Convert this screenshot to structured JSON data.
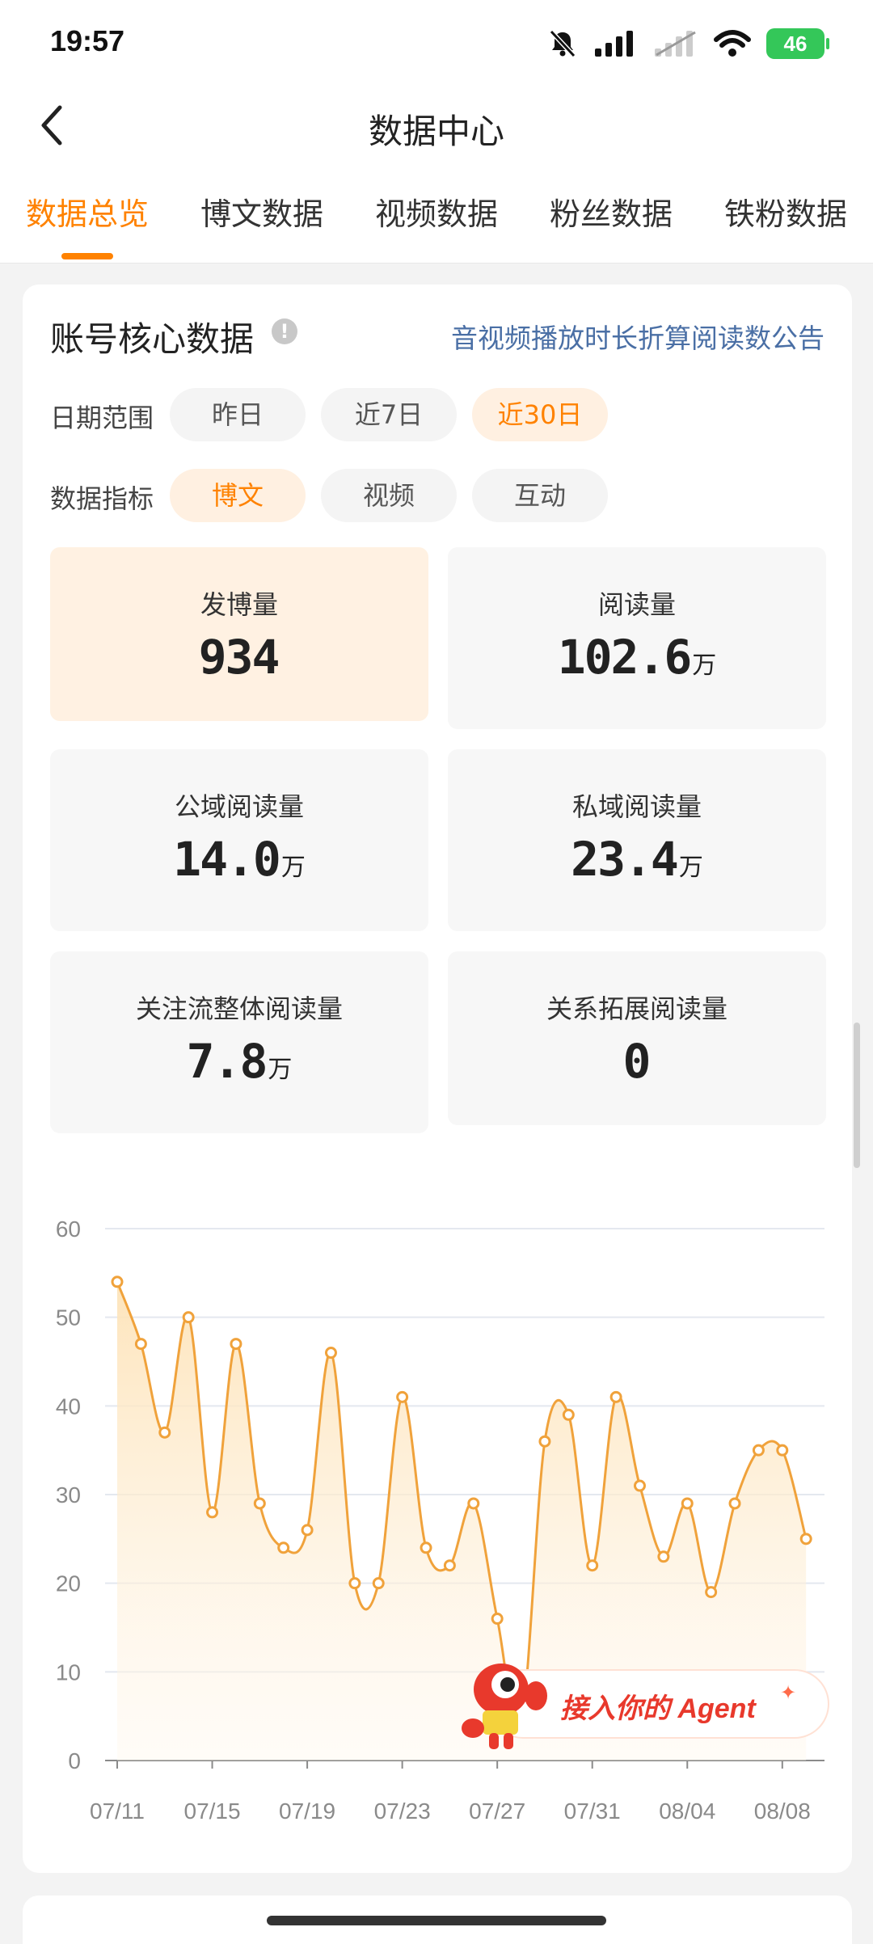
{
  "status_bar": {
    "time": "19:57",
    "battery": "46"
  },
  "header": {
    "title": "数据中心"
  },
  "tabs": [
    {
      "label": "数据总览"
    },
    {
      "label": "博文数据"
    },
    {
      "label": "视频数据"
    },
    {
      "label": "粉丝数据"
    },
    {
      "label": "铁粉数据"
    }
  ],
  "card": {
    "title": "账号核心数据",
    "info_icon": "!",
    "announcement": "音视频播放时长折算阅读数公告",
    "date_range": {
      "label": "日期范围",
      "options": [
        "昨日",
        "近7日",
        "近30日"
      ],
      "selected": "近30日"
    },
    "metric": {
      "label": "数据指标",
      "options": [
        "博文",
        "视频",
        "互动"
      ],
      "selected": "博文"
    },
    "stats": [
      {
        "label": "发博量",
        "value": "934",
        "unit": ""
      },
      {
        "label": "阅读量",
        "value": "102.6",
        "unit": "万"
      },
      {
        "label": "公域阅读量",
        "value": "14.0",
        "unit": "万"
      },
      {
        "label": "私域阅读量",
        "value": "23.4",
        "unit": "万"
      },
      {
        "label": "关注流整体阅读量",
        "value": "7.8",
        "unit": "万"
      },
      {
        "label": "关系拓展阅读量",
        "value": "0",
        "unit": ""
      }
    ]
  },
  "agent_banner": {
    "text": "接入你的 Agent"
  },
  "colors": {
    "accent": "#ff8200",
    "link": "#4a6fa5",
    "line": "#f0a23b",
    "active_bg": "#fff1e2"
  },
  "chart_data": {
    "type": "area",
    "x": [
      "07/11",
      "07/12",
      "07/13",
      "07/14",
      "07/15",
      "07/16",
      "07/17",
      "07/18",
      "07/19",
      "07/20",
      "07/21",
      "07/22",
      "07/23",
      "07/24",
      "07/25",
      "07/26",
      "07/27",
      "07/28",
      "07/29",
      "07/30",
      "07/31",
      "08/01",
      "08/02",
      "08/03",
      "08/04",
      "08/05",
      "08/06",
      "08/07",
      "08/08",
      "08/09"
    ],
    "values": [
      54,
      47,
      37,
      50,
      28,
      47,
      29,
      24,
      26,
      46,
      20,
      20,
      41,
      24,
      22,
      29,
      16,
      4,
      36,
      39,
      22,
      41,
      31,
      23,
      29,
      19,
      29,
      35,
      35,
      25
    ],
    "xticks": [
      "07/11",
      "07/15",
      "07/19",
      "07/23",
      "07/27",
      "07/31",
      "08/04",
      "08/08"
    ],
    "yticks": [
      0,
      10,
      20,
      30,
      40,
      50,
      60
    ],
    "ylim": [
      0,
      60
    ],
    "grid": true
  }
}
